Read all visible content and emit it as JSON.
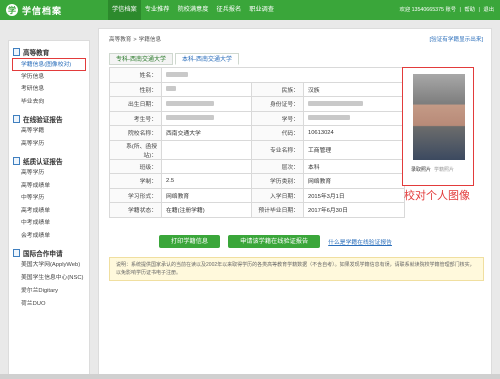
{
  "header": {
    "logo_mark": "学",
    "logo_text": "学信档案",
    "nav": [
      "学信档案",
      "专业推荐",
      "院校满意度",
      "征兵报名",
      "职业调查"
    ],
    "user": {
      "welcome": "欢迎 13540665375 账号",
      "help": "帮助",
      "logout": "退出",
      "sep": "|"
    }
  },
  "sidebar": {
    "groups": [
      {
        "title": "高等教育",
        "items": [
          "学籍信息(图像校对)",
          "学历信息",
          "考研信息",
          "毕业去向"
        ]
      },
      {
        "title": "在线验证报告",
        "items": [
          "高等学籍",
          "高等学历"
        ]
      },
      {
        "title": "纸质认证报告",
        "items": [
          "高等学历",
          "高等成绩单",
          "中等学历",
          "高考成绩单",
          "中考成绩单",
          "会考成绩单"
        ]
      },
      {
        "title": "国际合作申请",
        "items": [
          "美国大学网(ApplyWeb)",
          "美国学生信息中心(NSC)",
          "爱尔兰Digitary",
          "荷兰DUO"
        ]
      }
    ]
  },
  "main": {
    "breadcrumb": [
      "高等教育",
      "学籍信息"
    ],
    "top_link": "[验证有学籍显示出来]",
    "tabs": [
      "专科-西南交通大学",
      "本科-西南交通大学"
    ],
    "labels": {
      "name": "姓名：",
      "gender": "性别：",
      "ethnic": "民族：",
      "birth": "出生日期：",
      "id": "身份证号：",
      "exam": "考生号：",
      "stuid": "学号：",
      "school": "院校名称：",
      "code": "代码：",
      "dept": "系(所、函授站)：",
      "major": "专业名称：",
      "class": "班级：",
      "level": "层次：",
      "system": "学制：",
      "type": "学历类别：",
      "form": "学习形式：",
      "enroll": "入学日期：",
      "status": "学籍状态：",
      "grad": "预计毕业日期："
    },
    "values": {
      "ethnic": "汉族",
      "school": "西南交通大学",
      "code": "10613024",
      "major": "工商管理",
      "level": "本科",
      "system": "2.5",
      "type": "网络教育",
      "form": "网络教育",
      "enroll": "2015年3月1日",
      "status": "在籍(注册学籍)",
      "grad": "2017年6月30日"
    },
    "photo": {
      "caption_a": "录取照片",
      "caption_b": "学籍照片"
    },
    "annotation": "校对个人图像",
    "buttons": {
      "print": "打印学籍信息",
      "apply": "申请该学籍在线验证报告"
    },
    "help_link": "什么是学籍在线验证报告",
    "notice": "说明：系统提供国家承认的当前在读以及2002年以来取得学历的各类高等教育学籍数据（不含自考）。如果发现学籍信息有误，请联系就读院校学籍管理部门核实，以免影响学历证书电子注册。"
  },
  "colors": {
    "brand": "#3aa63a",
    "accent": "#e23b3b",
    "link": "#2a6ebb"
  }
}
